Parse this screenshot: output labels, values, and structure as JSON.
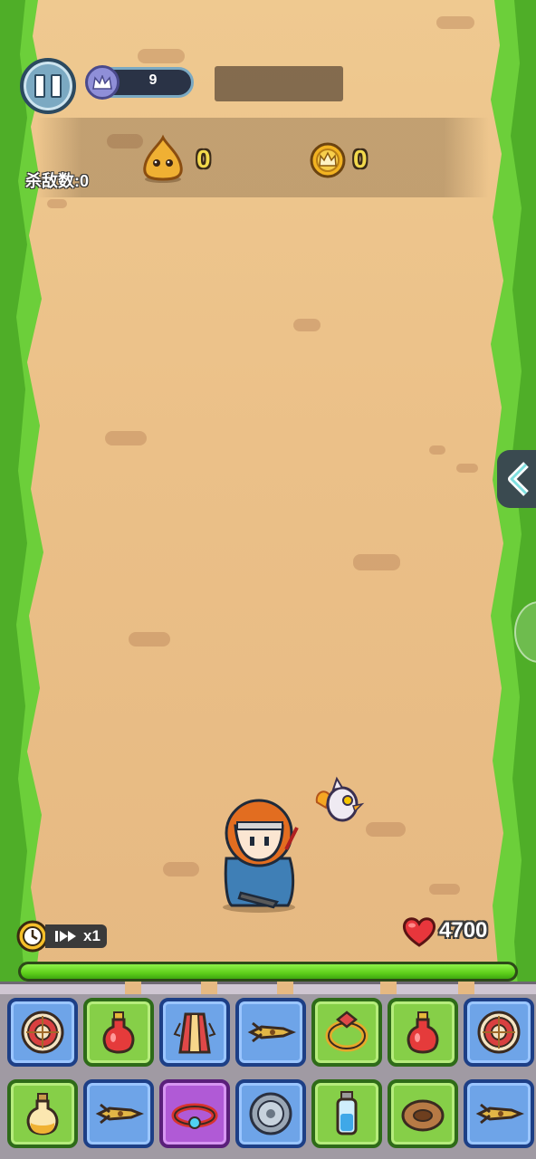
{
  "hud": {
    "level": "9",
    "kill_label": "杀敌数:0",
    "slime_count": "0",
    "coin_count": "0",
    "speed_label": "x1",
    "hp_value": "4700",
    "hp_fraction": 1.0
  },
  "colors": {
    "sand": "#e9c089",
    "grass": "#6ccf3a",
    "hp_fill": "#5fcf1b",
    "slot_blue": "#6ea4e8",
    "slot_green": "#86cf48",
    "slot_purple": "#b05ad6"
  },
  "inventory": {
    "row1": [
      {
        "item": "shield-icon",
        "rarity": "blue"
      },
      {
        "item": "red-potion-icon",
        "rarity": "green"
      },
      {
        "item": "robe-icon",
        "rarity": "blue"
      },
      {
        "item": "dart-icon",
        "rarity": "blue"
      },
      {
        "item": "ring-icon",
        "rarity": "green"
      },
      {
        "item": "red-potion-icon",
        "rarity": "green"
      },
      {
        "item": "shield-icon",
        "rarity": "blue"
      }
    ],
    "row2": [
      {
        "item": "yellow-potion-icon",
        "rarity": "green"
      },
      {
        "item": "dart-icon",
        "rarity": "blue"
      },
      {
        "item": "belt-ring-icon",
        "rarity": "purple"
      },
      {
        "item": "round-shield-icon",
        "rarity": "blue"
      },
      {
        "item": "blue-potion-icon",
        "rarity": "green"
      },
      {
        "item": "donut-ring-icon",
        "rarity": "green"
      },
      {
        "item": "dart-icon",
        "rarity": "blue"
      }
    ]
  }
}
